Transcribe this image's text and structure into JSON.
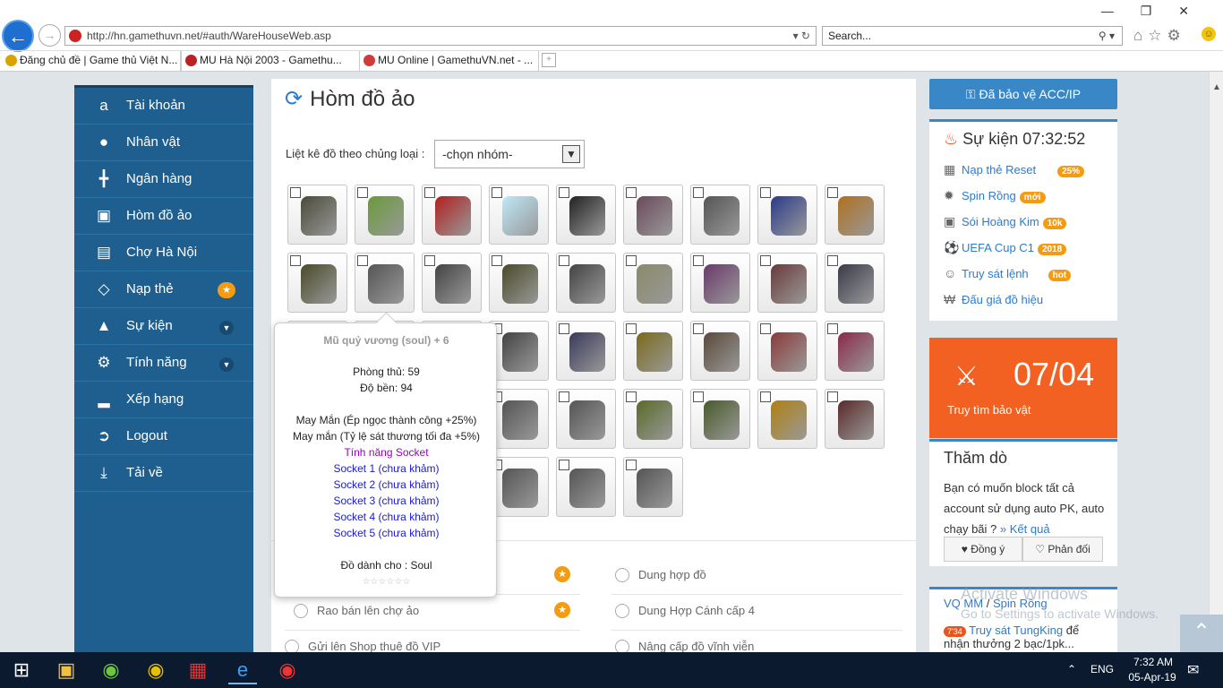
{
  "browser": {
    "url": "http://hn.gamethuvn.net/#auth/WareHouseWeb.asp",
    "search_placeholder": "Search...",
    "tabs": [
      {
        "label": "Đăng chủ đề | Game thủ Việt N..."
      },
      {
        "label": "MU Hà Nội 2003 - Gamethu..."
      },
      {
        "label": "MU Online | GamethuVN.net - ..."
      }
    ]
  },
  "sidebar": {
    "items": [
      {
        "label": "Tài khoản",
        "icon": "amazon-icon"
      },
      {
        "label": "Nhân vật",
        "icon": "user-icon"
      },
      {
        "label": "Ngân hàng",
        "icon": "bank-icon"
      },
      {
        "label": "Hòm đồ ảo",
        "icon": "briefcase-icon"
      },
      {
        "label": "Chợ Hà Nội",
        "icon": "cart-icon"
      },
      {
        "label": "Nạp thẻ",
        "icon": "diamond-icon"
      },
      {
        "label": "Sự kiện",
        "icon": "android-icon"
      },
      {
        "label": "Tính năng",
        "icon": "cogs-icon"
      },
      {
        "label": "Xếp hạng",
        "icon": "bar-chart-icon"
      },
      {
        "label": "Logout",
        "icon": "logout-icon"
      },
      {
        "label": "Tải về",
        "icon": "download-icon"
      }
    ]
  },
  "main": {
    "title": "Hòm đồ ảo",
    "filter_label": "Liệt kê đồ theo chủng loại :",
    "filter_value": "-chọn nhóm-",
    "options": [
      {
        "label": "Dung hợp đồ"
      },
      {
        "label": "Rao bán lên chợ ảo"
      },
      {
        "label": "Dung Hợp Cánh cấp 4"
      },
      {
        "label": "Gửi lên Shop thuê đồ VIP"
      },
      {
        "label": "Nâng cấp đồ vĩnh viễn"
      }
    ]
  },
  "tooltip": {
    "name": "Mũ quỷ vương (soul) + 6",
    "defense": "Phòng thủ: 59",
    "durability": "Độ bền: 94",
    "luck1": "May Mắn (Ép ngọc thành công +25%)",
    "luck2": "May mắn (Tỷ lệ sát thương tối đa +5%)",
    "socket_title": "Tính năng Socket",
    "sockets": [
      "Socket 1 (chưa khảm)",
      "Socket 2 (chưa khảm)",
      "Socket 3 (chưa khảm)",
      "Socket 4 (chưa khảm)",
      "Socket 5 (chưa khảm)"
    ],
    "for_class": "Đồ dành cho : Soul",
    "stars": "☆☆☆☆☆☆"
  },
  "right": {
    "protect_btn": "Đã bảo vệ ACC/IP",
    "event_title": "Sự kiện 07:32:52",
    "events": [
      {
        "label": "Nạp thẻ Reset",
        "tag": "25%"
      },
      {
        "label": "Spin Rồng",
        "tag": "mới"
      },
      {
        "label": "Sói Hoàng Kim",
        "tag": "10k"
      },
      {
        "label": "UEFA Cup C1",
        "tag": "2018"
      },
      {
        "label": "Truy sát lệnh",
        "tag": "hot"
      },
      {
        "label": "Đấu giá đồ hiệu",
        "tag": ""
      }
    ],
    "promo_date": "07/04",
    "promo_text": "Truy tìm bảo vật",
    "poll_title": "Thăm dò",
    "poll_text": "Bạn có muốn block tất cả account sử dụng auto PK, auto chạy bãi ?",
    "poll_result": "» Kết quả",
    "poll_yes": "Đồng ý",
    "poll_no": "Phản đối",
    "vq_a": "VQ MM",
    "vq_sep": "/",
    "vq_b": "Spin Rồng",
    "news_time": "7'34",
    "news_link": "Truy sát TungKing",
    "news_rest": "để",
    "news_more": "nhận thưởng 2 bạc/1pk..."
  },
  "watermark": {
    "line1": "Activate Windows",
    "line2": "Go to Settings to activate Windows."
  },
  "taskbar": {
    "lang": "ENG",
    "time": "7:32 AM",
    "date": "05-Apr-19"
  }
}
